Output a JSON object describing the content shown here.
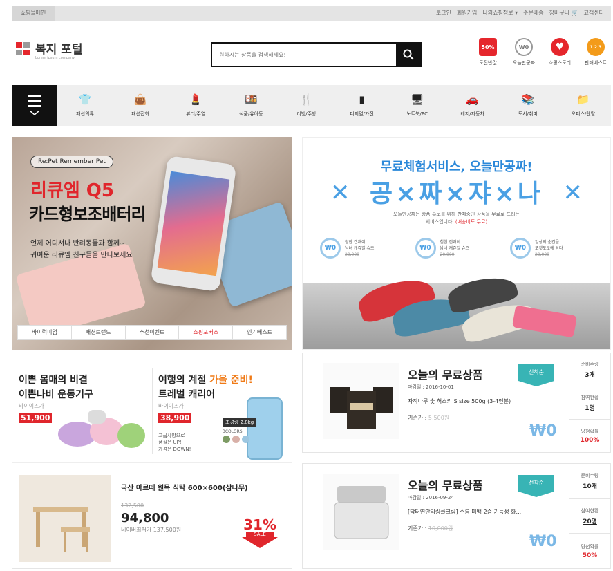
{
  "topbar": {
    "left_label": "쇼핑몰메인",
    "links": [
      "로그인",
      "회원가입",
      "나의쇼핑정보 ▾",
      "주문배송",
      "장바구니 🛒",
      "고객센터"
    ]
  },
  "header": {
    "logo": "복지 포털",
    "logo_sub": "Lorem ipsum company",
    "search_placeholder": "원하시는 상품을 검색해세요!",
    "quick": [
      {
        "label": "도전반값",
        "icon": "50%",
        "color": "#e5262c"
      },
      {
        "label": "오늘만공짜",
        "icon": "W0",
        "color": "#8c8c8c"
      },
      {
        "label": "쇼핑스토리",
        "icon": "♥",
        "color": "#e5262c"
      },
      {
        "label": "판매베스트",
        "icon": "1 2 3",
        "color": "#f39b1a"
      }
    ]
  },
  "categories": [
    {
      "label": "패션의류",
      "icon": "shirt-icon",
      "glyph": "👕"
    },
    {
      "label": "패션잡화",
      "icon": "bag-icon",
      "glyph": "👜"
    },
    {
      "label": "뷰티/주얼",
      "icon": "cosmetics-icon",
      "glyph": "💄"
    },
    {
      "label": "식품/유아동",
      "icon": "food-icon",
      "glyph": "🍱"
    },
    {
      "label": "리빙/주방",
      "icon": "kitchen-icon",
      "glyph": "🍴"
    },
    {
      "label": "디지털/가전",
      "icon": "appliance-icon",
      "glyph": "▮"
    },
    {
      "label": "노트북/PC",
      "icon": "monitor-icon",
      "glyph": "🖥"
    },
    {
      "label": "레저/자동차",
      "icon": "car-icon",
      "glyph": "🚗"
    },
    {
      "label": "도서/취미",
      "icon": "book-icon",
      "glyph": "📚"
    },
    {
      "label": "오피스/렌탈",
      "icon": "folder-icon",
      "glyph": "📁"
    }
  ],
  "banner_left": {
    "badge": "Re:Pet Remember Pet",
    "title1": "리큐엠 Q5",
    "title2": "카드형보조배터리",
    "desc1": "언제 어디서나 반려동물과 함께~",
    "desc2": "귀여운 리큐엠 친구들을 만나보세요",
    "tabs": [
      "바이럭미업",
      "패션트랜드",
      "추천이벤트",
      "쇼핑포커스",
      "인기베스트"
    ],
    "active_tab": 3
  },
  "banner_right": {
    "title": "무료체험서비스, 오늘만공짜!",
    "big": "공×짜×쟈×나",
    "desc1": "오늘만공짜는 상품 홍보를 위해 판매중인 상품을 무료로 드리는",
    "desc2_a": "서비스입니다.",
    "desc2_b": "(배송비도 무료)",
    "items": [
      {
        "name1": "첨한 캡쾌이",
        "name2": "남녀 캐쥬얼 슈즈",
        "price": "20,000"
      },
      {
        "name1": "첨한 캡쾌이",
        "name2": "남녀 캐쥬얼 슈즈",
        "price": "20,000"
      },
      {
        "name1": "일상의 순간을",
        "name2": "포켓포토에 담다",
        "price": "20,000"
      }
    ]
  },
  "promo1": {
    "left": {
      "line1": "이쁜 몸매의 비결",
      "line2": "이쁜나비 운동기구",
      "brand": "바이이즈가",
      "price": "51,900"
    },
    "right": {
      "line1a": "여행의 계절 ",
      "line1b": "가을 준비!",
      "line2": "트레벌 캐리어",
      "brand": "바이이즈가",
      "price": "38,900",
      "spec": "초경량 2.8kg",
      "colors": "3COLORS",
      "desc1": "고급사양으로",
      "desc2": "품질은 UP!",
      "desc3": "가격은 DOWN!"
    }
  },
  "promo2": {
    "title": "국산 아르떼 원목 식탁 600×600(삼나무)",
    "old_price": "132,500",
    "price": "94,800",
    "naver": "네이버최저가 137,500원",
    "sale_pct": "31%",
    "sale_label": "SALE"
  },
  "free_items": [
    {
      "title": "오늘의 무료상품",
      "tag": "선착순",
      "due": "마감일 : 2016-10-01",
      "name": "자작나무 숯 허스키 S size 500g (3-4인분)",
      "orig_label": "기존가 : ",
      "orig": "5,500원",
      "won": "₩0",
      "stats": [
        {
          "l": "준비수량",
          "v": "3개",
          "s": ""
        },
        {
          "l": "참여현황",
          "v": "1명",
          "s": "u"
        },
        {
          "l": "당첨확률",
          "v": "100%",
          "s": "r"
        }
      ]
    },
    {
      "title": "오늘의 무료상품",
      "tag": "선착순",
      "due": "마감일 : 2016-09-24",
      "name": "[닥터연안티링클크림] 주름 미백 2중 기능성 화...",
      "orig_label": "기존가 : ",
      "orig": "10,000원",
      "won": "₩0",
      "stats": [
        {
          "l": "준비수량",
          "v": "10개",
          "s": ""
        },
        {
          "l": "참여현황",
          "v": "20명",
          "s": "u"
        },
        {
          "l": "당첨확률",
          "v": "50%",
          "s": "r"
        }
      ]
    }
  ]
}
